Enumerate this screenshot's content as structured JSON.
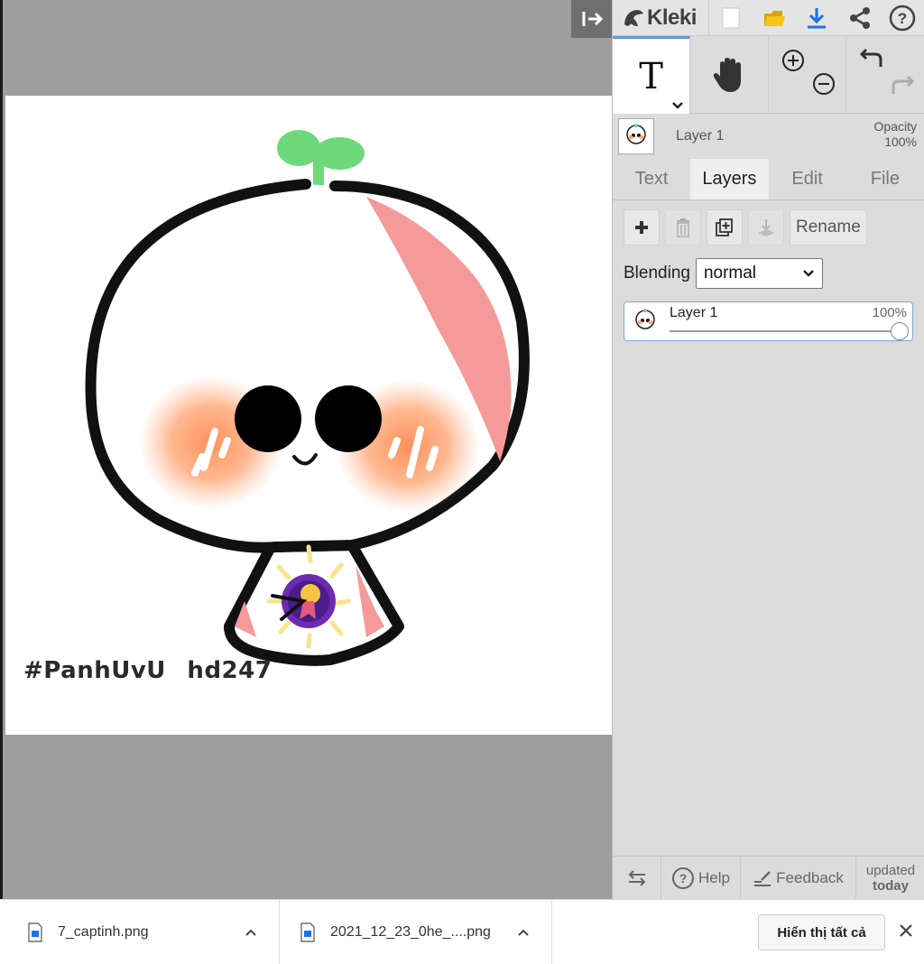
{
  "app": {
    "name": "Kleki"
  },
  "canvas": {
    "watermark": "#PanhUvU  hd247"
  },
  "layer_bar": {
    "name": "Layer 1",
    "opacity_label": "Opacity",
    "opacity_value": "100%"
  },
  "tabs": [
    {
      "label": "Text"
    },
    {
      "label": "Layers"
    },
    {
      "label": "Edit"
    },
    {
      "label": "File"
    }
  ],
  "layers_panel": {
    "rename_label": "Rename",
    "blending_label": "Blending",
    "blending_value": "normal",
    "layers": [
      {
        "name": "Layer 1",
        "opacity": "100%"
      }
    ]
  },
  "bottom_bar": {
    "help_label": "Help",
    "feedback_label": "Feedback",
    "updated_line1": "updated",
    "updated_line2": "today"
  },
  "downloads": {
    "items": [
      {
        "filename": "7_captinh.png"
      },
      {
        "filename": "2021_12_23_0he_....png"
      }
    ],
    "show_all_label": "Hiển thị tất cả"
  },
  "colors": {
    "accent": "#5b9ad8",
    "panel_bg": "#dcdcdc",
    "canvas_bg": "#9e9e9e",
    "download_blue": "#1a73e8",
    "folder_yellow": "#f5c518"
  }
}
